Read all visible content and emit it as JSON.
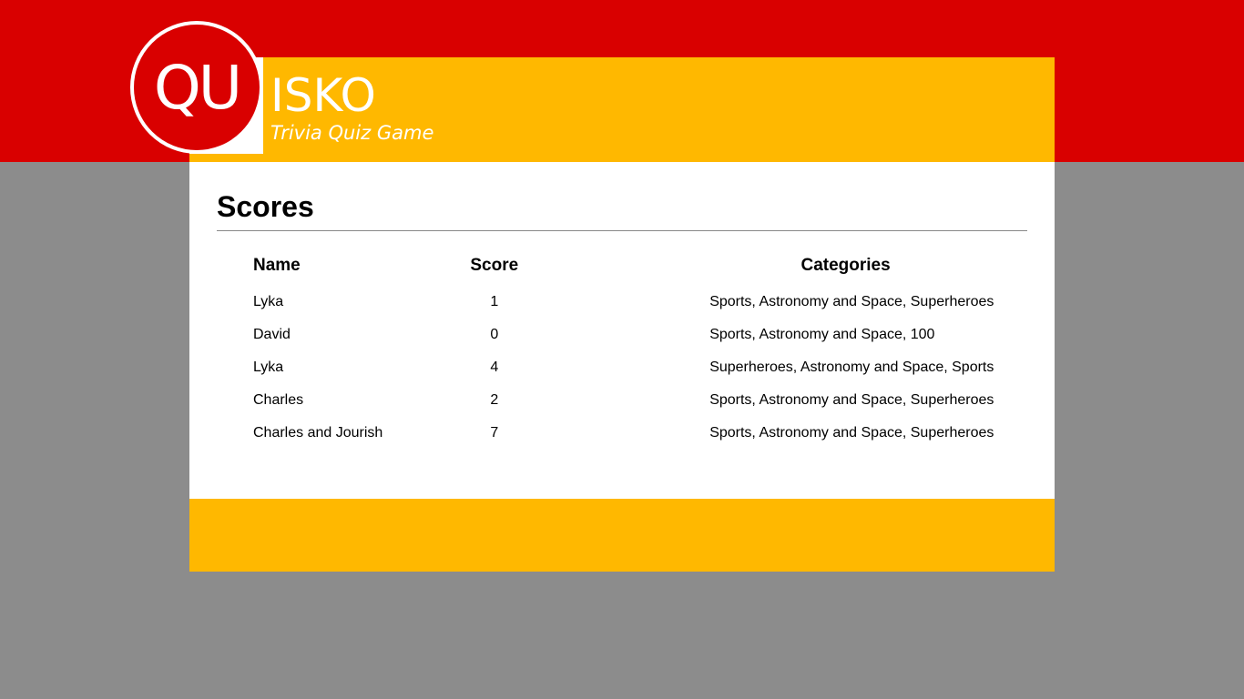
{
  "brand": {
    "logo_text": "QU",
    "name": "ISKO",
    "tagline": "Trivia Quiz Game"
  },
  "page": {
    "title": "Scores"
  },
  "table": {
    "headers": {
      "name": "Name",
      "score": "Score",
      "categories": "Categories"
    },
    "rows": [
      {
        "name": "Lyka",
        "score": "1",
        "categories": "Sports, Astronomy and Space, Superheroes"
      },
      {
        "name": "David",
        "score": "0",
        "categories": "Sports, Astronomy and Space, 100"
      },
      {
        "name": "Lyka",
        "score": "4",
        "categories": "Superheroes, Astronomy and Space, Sports"
      },
      {
        "name": "Charles",
        "score": "2",
        "categories": "Sports, Astronomy and Space, Superheroes"
      },
      {
        "name": "Charles and Jourish",
        "score": "7",
        "categories": "Sports, Astronomy and Space, Superheroes"
      }
    ]
  },
  "colors": {
    "red": "#d90000",
    "yellow": "#ffb800",
    "gray": "#8c8c8c",
    "white": "#ffffff"
  }
}
